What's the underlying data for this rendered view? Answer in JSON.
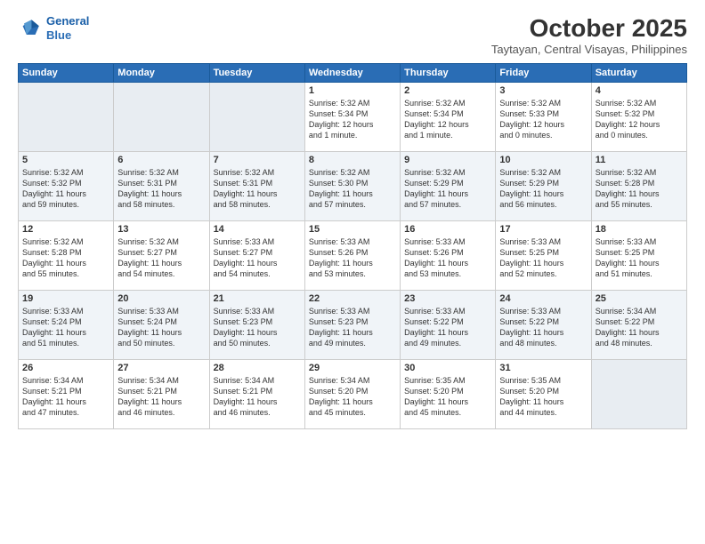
{
  "header": {
    "logo_line1": "General",
    "logo_line2": "Blue",
    "month": "October 2025",
    "location": "Taytayan, Central Visayas, Philippines"
  },
  "weekdays": [
    "Sunday",
    "Monday",
    "Tuesday",
    "Wednesday",
    "Thursday",
    "Friday",
    "Saturday"
  ],
  "weeks": [
    [
      {
        "day": "",
        "text": ""
      },
      {
        "day": "",
        "text": ""
      },
      {
        "day": "",
        "text": ""
      },
      {
        "day": "1",
        "text": "Sunrise: 5:32 AM\nSunset: 5:34 PM\nDaylight: 12 hours\nand 1 minute."
      },
      {
        "day": "2",
        "text": "Sunrise: 5:32 AM\nSunset: 5:34 PM\nDaylight: 12 hours\nand 1 minute."
      },
      {
        "day": "3",
        "text": "Sunrise: 5:32 AM\nSunset: 5:33 PM\nDaylight: 12 hours\nand 0 minutes."
      },
      {
        "day": "4",
        "text": "Sunrise: 5:32 AM\nSunset: 5:32 PM\nDaylight: 12 hours\nand 0 minutes."
      }
    ],
    [
      {
        "day": "5",
        "text": "Sunrise: 5:32 AM\nSunset: 5:32 PM\nDaylight: 11 hours\nand 59 minutes."
      },
      {
        "day": "6",
        "text": "Sunrise: 5:32 AM\nSunset: 5:31 PM\nDaylight: 11 hours\nand 58 minutes."
      },
      {
        "day": "7",
        "text": "Sunrise: 5:32 AM\nSunset: 5:31 PM\nDaylight: 11 hours\nand 58 minutes."
      },
      {
        "day": "8",
        "text": "Sunrise: 5:32 AM\nSunset: 5:30 PM\nDaylight: 11 hours\nand 57 minutes."
      },
      {
        "day": "9",
        "text": "Sunrise: 5:32 AM\nSunset: 5:29 PM\nDaylight: 11 hours\nand 57 minutes."
      },
      {
        "day": "10",
        "text": "Sunrise: 5:32 AM\nSunset: 5:29 PM\nDaylight: 11 hours\nand 56 minutes."
      },
      {
        "day": "11",
        "text": "Sunrise: 5:32 AM\nSunset: 5:28 PM\nDaylight: 11 hours\nand 55 minutes."
      }
    ],
    [
      {
        "day": "12",
        "text": "Sunrise: 5:32 AM\nSunset: 5:28 PM\nDaylight: 11 hours\nand 55 minutes."
      },
      {
        "day": "13",
        "text": "Sunrise: 5:32 AM\nSunset: 5:27 PM\nDaylight: 11 hours\nand 54 minutes."
      },
      {
        "day": "14",
        "text": "Sunrise: 5:33 AM\nSunset: 5:27 PM\nDaylight: 11 hours\nand 54 minutes."
      },
      {
        "day": "15",
        "text": "Sunrise: 5:33 AM\nSunset: 5:26 PM\nDaylight: 11 hours\nand 53 minutes."
      },
      {
        "day": "16",
        "text": "Sunrise: 5:33 AM\nSunset: 5:26 PM\nDaylight: 11 hours\nand 53 minutes."
      },
      {
        "day": "17",
        "text": "Sunrise: 5:33 AM\nSunset: 5:25 PM\nDaylight: 11 hours\nand 52 minutes."
      },
      {
        "day": "18",
        "text": "Sunrise: 5:33 AM\nSunset: 5:25 PM\nDaylight: 11 hours\nand 51 minutes."
      }
    ],
    [
      {
        "day": "19",
        "text": "Sunrise: 5:33 AM\nSunset: 5:24 PM\nDaylight: 11 hours\nand 51 minutes."
      },
      {
        "day": "20",
        "text": "Sunrise: 5:33 AM\nSunset: 5:24 PM\nDaylight: 11 hours\nand 50 minutes."
      },
      {
        "day": "21",
        "text": "Sunrise: 5:33 AM\nSunset: 5:23 PM\nDaylight: 11 hours\nand 50 minutes."
      },
      {
        "day": "22",
        "text": "Sunrise: 5:33 AM\nSunset: 5:23 PM\nDaylight: 11 hours\nand 49 minutes."
      },
      {
        "day": "23",
        "text": "Sunrise: 5:33 AM\nSunset: 5:22 PM\nDaylight: 11 hours\nand 49 minutes."
      },
      {
        "day": "24",
        "text": "Sunrise: 5:33 AM\nSunset: 5:22 PM\nDaylight: 11 hours\nand 48 minutes."
      },
      {
        "day": "25",
        "text": "Sunrise: 5:34 AM\nSunset: 5:22 PM\nDaylight: 11 hours\nand 48 minutes."
      }
    ],
    [
      {
        "day": "26",
        "text": "Sunrise: 5:34 AM\nSunset: 5:21 PM\nDaylight: 11 hours\nand 47 minutes."
      },
      {
        "day": "27",
        "text": "Sunrise: 5:34 AM\nSunset: 5:21 PM\nDaylight: 11 hours\nand 46 minutes."
      },
      {
        "day": "28",
        "text": "Sunrise: 5:34 AM\nSunset: 5:21 PM\nDaylight: 11 hours\nand 46 minutes."
      },
      {
        "day": "29",
        "text": "Sunrise: 5:34 AM\nSunset: 5:20 PM\nDaylight: 11 hours\nand 45 minutes."
      },
      {
        "day": "30",
        "text": "Sunrise: 5:35 AM\nSunset: 5:20 PM\nDaylight: 11 hours\nand 45 minutes."
      },
      {
        "day": "31",
        "text": "Sunrise: 5:35 AM\nSunset: 5:20 PM\nDaylight: 11 hours\nand 44 minutes."
      },
      {
        "day": "",
        "text": ""
      }
    ]
  ]
}
